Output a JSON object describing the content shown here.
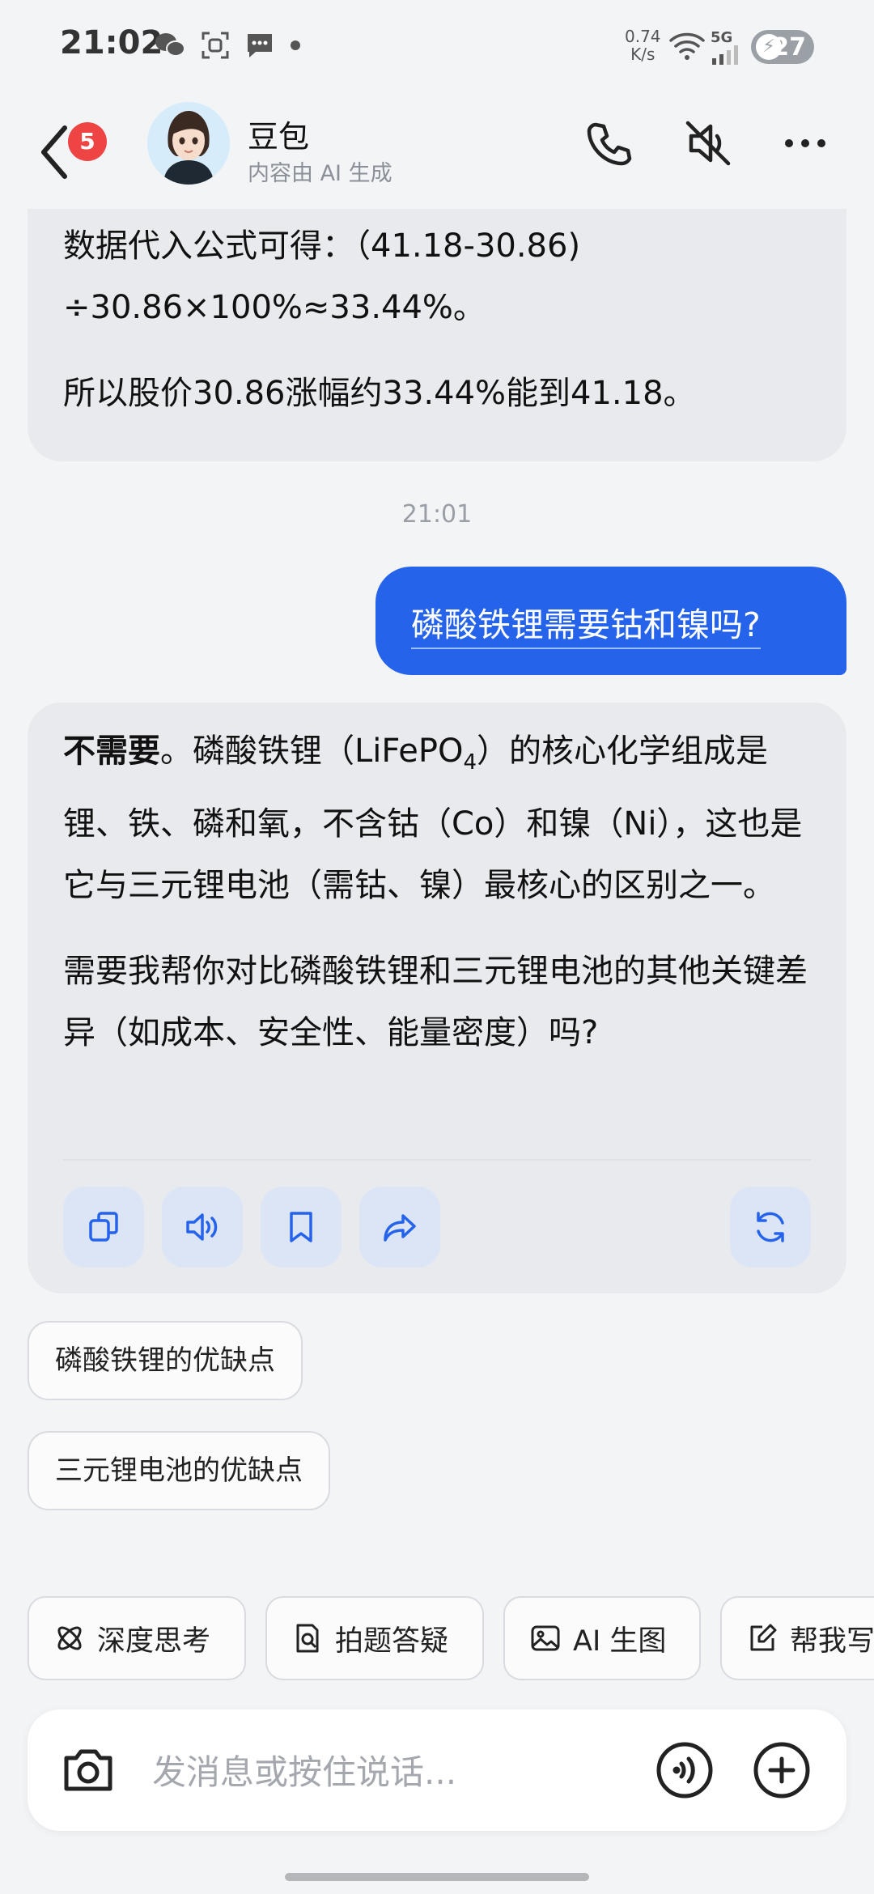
{
  "status_bar": {
    "time": "21:02",
    "net_speed_value": "0.74",
    "net_speed_unit": "K/s",
    "network": "5G",
    "battery": "27"
  },
  "header": {
    "unread_count": "5",
    "bot_name": "豆包",
    "bot_subtitle": "内容由 AI 生成"
  },
  "messages": {
    "prev_ai": {
      "line1": "数据代入公式可得：（41.18-30.86)",
      "line2": "÷30.86×100%≈33.44%。",
      "line3": "所以股价30.86涨幅约33.44%能到41.18。"
    },
    "timestamp": "21:01",
    "user_question": "磷酸铁锂需要钴和镍吗?",
    "answer": {
      "bold": "不需要",
      "p1_a": "。磷酸铁锂（LiFePO",
      "p1_sub": "4",
      "p1_b": "）的核心化学组成是锂、铁、磷和氧，不含钴（Co）和镍（Ni），这也是它与三元锂电池（需钴、镍）最核心的区别之一。",
      "p2": "需要我帮你对比磷酸铁锂和三元锂电池的其他关键差异（如成本、安全性、能量密度）吗?"
    }
  },
  "suggestions": [
    "磷酸铁锂的优缺点",
    "三元锂电池的优缺点"
  ],
  "tools": [
    "深度思考",
    "拍题答疑",
    "AI 生图",
    "帮我写"
  ],
  "input": {
    "placeholder": "发消息或按住说话..."
  },
  "colors": {
    "accent": "#2563eb",
    "badge": "#ef4444",
    "bubble": "#e8eaee"
  }
}
